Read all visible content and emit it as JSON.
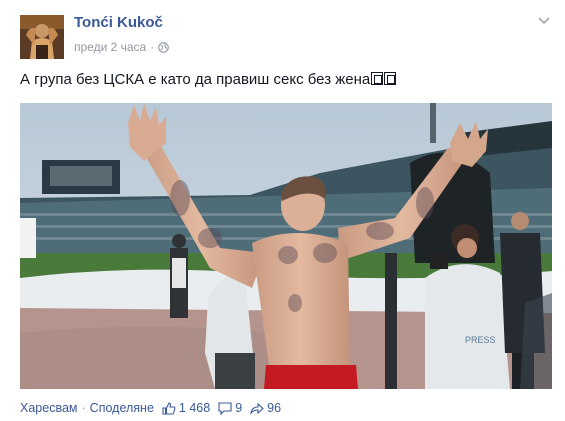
{
  "post": {
    "author": "Tonći Kukoč",
    "timestamp": "преди 2 часа",
    "privacy_icon": "globe-icon",
    "menu_icon": "chevron-down-icon",
    "text": "А група без ЦСКА е като да правиш секс без жена",
    "photo_icon": "football-player-celebration-photo"
  },
  "actions": {
    "like_label": "Харесвам",
    "separator": "·",
    "share_label": "Споделяне",
    "likes_count": "1 468",
    "comments_count": "9",
    "shares_count": "96",
    "like_icon": "thumbs-up-icon",
    "comment_icon": "comment-icon",
    "share_icon": "share-arrow-icon"
  },
  "colors": {
    "link": "#3b5998",
    "meta": "#9197a3",
    "text": "#141823"
  }
}
